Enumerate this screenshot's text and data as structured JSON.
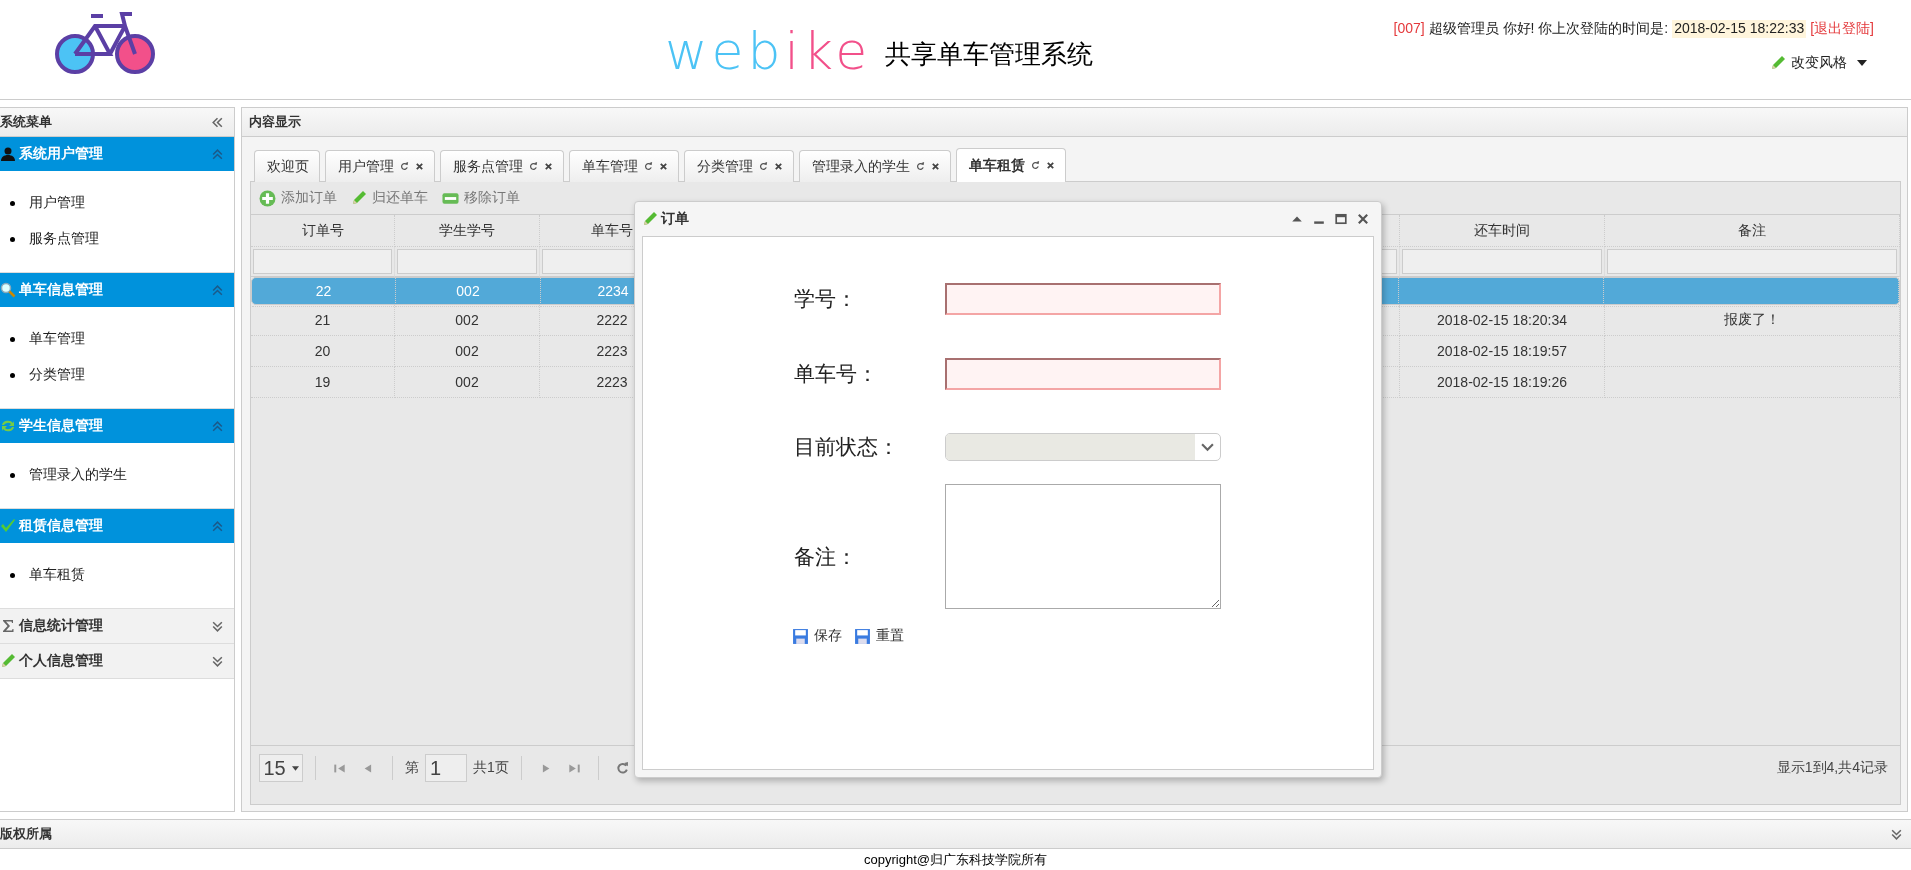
{
  "header": {
    "logo_parts": [
      {
        "text": "web",
        "color": "#4cc3f5"
      },
      {
        "text": "ike",
        "color": "#f2508a"
      }
    ],
    "subtitle": "共享单车管理系统",
    "user_id": "[007]",
    "greeting": "超级管理员 你好! 你上次登陆的时间是:",
    "last_login": "2018-02-15 18:22:33",
    "logout": "[退出登陆]",
    "theme_button": "改变风格"
  },
  "sidebar": {
    "title": "系统菜单",
    "groups": [
      {
        "title": "系统用户管理",
        "kind": "user",
        "expanded": true,
        "items": [
          "用户管理",
          "服务点管理"
        ]
      },
      {
        "title": "单车信息管理",
        "kind": "search",
        "expanded": true,
        "items": [
          "单车管理",
          "分类管理"
        ]
      },
      {
        "title": "学生信息管理",
        "kind": "refresh",
        "expanded": true,
        "items": [
          "管理录入的学生"
        ]
      },
      {
        "title": "租赁信息管理",
        "kind": "check",
        "expanded": true,
        "items": [
          "单车租赁"
        ]
      },
      {
        "title": "信息统计管理",
        "kind": "sigma",
        "expanded": false
      },
      {
        "title": "个人信息管理",
        "kind": "pencil",
        "expanded": false
      }
    ]
  },
  "content": {
    "title": "内容显示",
    "tabs": [
      {
        "label": "欢迎页",
        "closable": false,
        "selected": false
      },
      {
        "label": "用户管理",
        "closable": true,
        "selected": false
      },
      {
        "label": "服务点管理",
        "closable": true,
        "selected": false
      },
      {
        "label": "单车管理",
        "closable": true,
        "selected": false
      },
      {
        "label": "分类管理",
        "closable": true,
        "selected": false
      },
      {
        "label": "管理录入的学生",
        "closable": true,
        "selected": false
      },
      {
        "label": "单车租赁",
        "closable": true,
        "selected": true
      }
    ],
    "toolbar": [
      {
        "label": "添加订单",
        "kind": "add"
      },
      {
        "label": "归还单车",
        "kind": "edit"
      },
      {
        "label": "移除订单",
        "kind": "remove"
      }
    ],
    "table": {
      "columns": [
        "订单号",
        "学生学号",
        "单车号",
        "还车时间",
        "备注"
      ],
      "rows": [
        {
          "selected": true,
          "cells": [
            "22",
            "002",
            "2234"
          ]
        },
        {
          "selected": false,
          "cells": [
            "21",
            "002",
            "2222",
            "2018-02-15 18:20:34",
            "报废了！"
          ]
        },
        {
          "selected": false,
          "cells": [
            "20",
            "002",
            "2223",
            "2018-02-15 18:19:57"
          ]
        },
        {
          "selected": false,
          "cells": [
            "19",
            "002",
            "2223",
            "2018-02-15 18:19:26"
          ]
        }
      ]
    },
    "pagination": {
      "page_size": "15",
      "page_prefix": "第",
      "page": "1",
      "page_total": "共1页",
      "summary": "显示1到4,共4记录"
    }
  },
  "dialog": {
    "title": "订单",
    "fields": [
      {
        "kind": "text",
        "label": "学号：",
        "invalid": true
      },
      {
        "kind": "text",
        "label": "单车号：",
        "invalid": true
      },
      {
        "kind": "select",
        "label": "目前状态："
      },
      {
        "kind": "textarea",
        "label": "备注："
      }
    ],
    "buttons": [
      "保存",
      "重置"
    ]
  },
  "footer": {
    "title": "版权所属",
    "copyright": "copyright@归广东科技学院所有"
  }
}
